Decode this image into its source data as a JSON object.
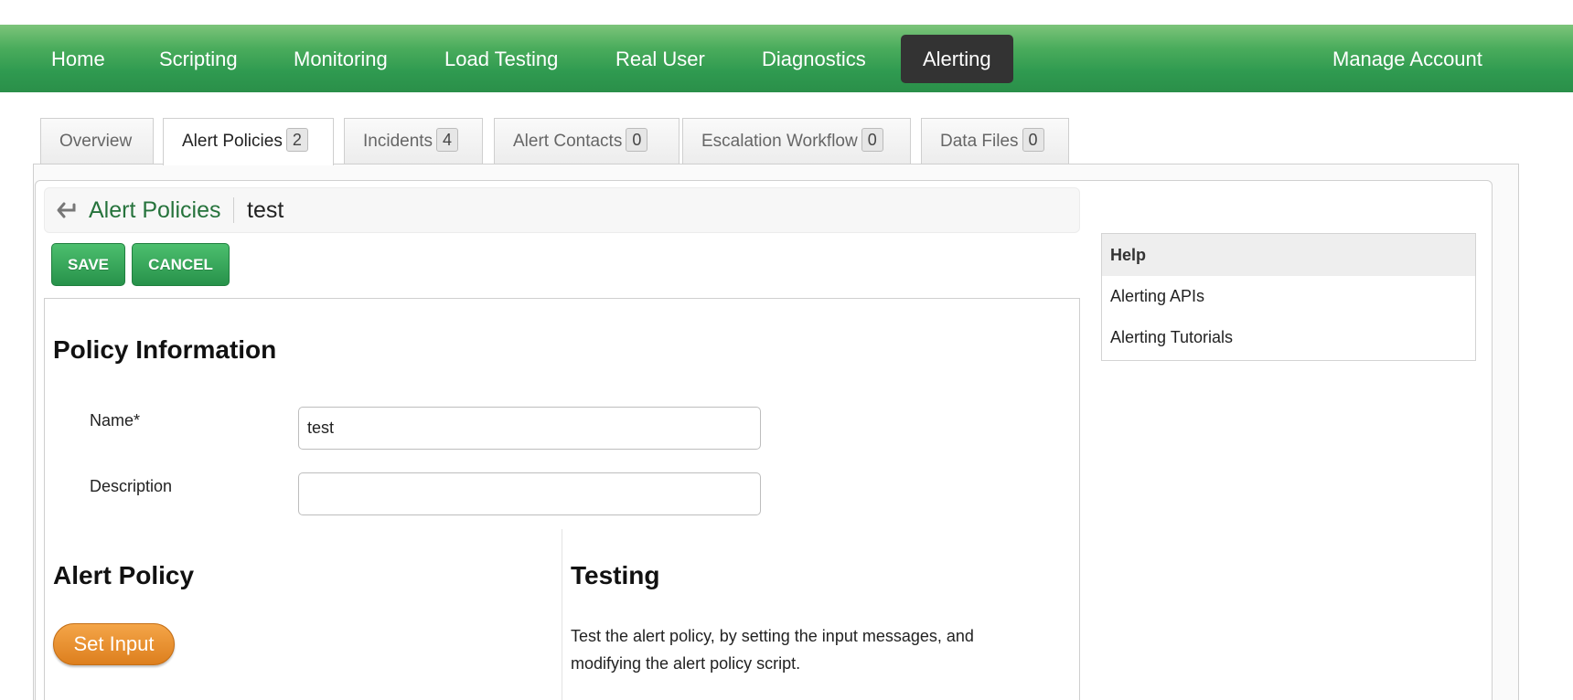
{
  "nav": {
    "items": [
      {
        "label": "Home"
      },
      {
        "label": "Scripting"
      },
      {
        "label": "Monitoring"
      },
      {
        "label": "Load Testing"
      },
      {
        "label": "Real User"
      },
      {
        "label": "Diagnostics"
      },
      {
        "label": "Alerting",
        "active": true
      }
    ],
    "account_label": "Manage Account"
  },
  "tabs": [
    {
      "label": "Overview",
      "count": ""
    },
    {
      "label": "Alert Policies",
      "count": "2",
      "active": true
    },
    {
      "label": "Incidents",
      "count": "4"
    },
    {
      "label": "Alert Contacts",
      "count": "0"
    },
    {
      "label": "Escalation Workflow",
      "count": "0"
    },
    {
      "label": "Data Files",
      "count": "0"
    }
  ],
  "breadcrumb": {
    "parent": "Alert Policies",
    "current": "test"
  },
  "actions": {
    "save_label": "SAVE",
    "cancel_label": "CANCEL"
  },
  "form": {
    "section_title": "Policy Information",
    "name_label": "Name*",
    "name_value": "test",
    "description_label": "Description",
    "description_value": "",
    "alert_policy_title": "Alert Policy",
    "set_input_label": "Set Input",
    "testing_title": "Testing",
    "testing_text": "Test the alert policy, by setting the input messages, and modifying the alert policy script."
  },
  "help": {
    "title": "Help",
    "items": [
      {
        "label": "Alerting APIs"
      },
      {
        "label": "Alerting Tutorials"
      }
    ]
  },
  "colors": {
    "nav_green": "#2f9a50",
    "active_nav": "#333333",
    "link_green": "#26733c",
    "orange_button": "#e88f2c"
  }
}
